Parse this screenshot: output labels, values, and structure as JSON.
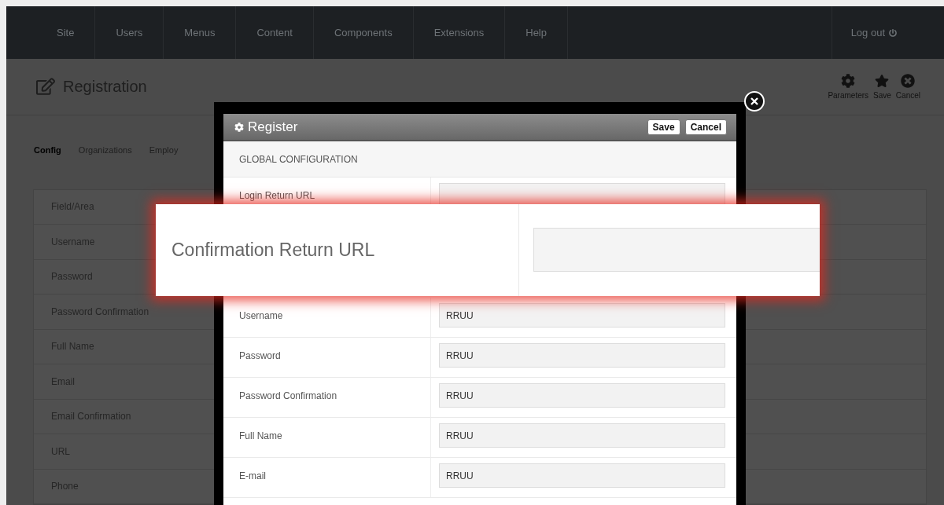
{
  "nav": {
    "items": [
      "Site",
      "Users",
      "Menus",
      "Content",
      "Components",
      "Extensions",
      "Help"
    ],
    "logout": "Log out"
  },
  "header": {
    "title": "Registration",
    "actions": [
      {
        "kind": "gear",
        "label": "Parameters"
      },
      {
        "kind": "star",
        "label": "Save"
      },
      {
        "kind": "cancel",
        "label": "Cancel"
      }
    ]
  },
  "tabs": [
    {
      "label": "Config",
      "selected": true
    },
    {
      "label": "Organizations",
      "selected": false
    },
    {
      "label": "Employ",
      "selected": false
    }
  ],
  "table": {
    "header": "Field/Area",
    "rows": [
      "Username",
      "Password",
      "Password Confirmation",
      "Full Name",
      "Email",
      "Email Confirmation",
      "URL",
      "Phone"
    ]
  },
  "modal": {
    "title": "Register",
    "buttons": [
      "Save",
      "Cancel"
    ],
    "section": "GLOBAL CONFIGURATION",
    "top_rows": [
      {
        "label": "Login Return URL"
      }
    ],
    "rows": [
      {
        "label": "Username",
        "value": "RRUU"
      },
      {
        "label": "Password",
        "value": "RRUU"
      },
      {
        "label": "Password Confirmation",
        "value": "RRUU"
      },
      {
        "label": "Full Name",
        "value": "RRUU"
      },
      {
        "label": "E-mail",
        "value": "RRUU"
      }
    ]
  },
  "highlight": {
    "label": "Confirmation Return URL"
  }
}
